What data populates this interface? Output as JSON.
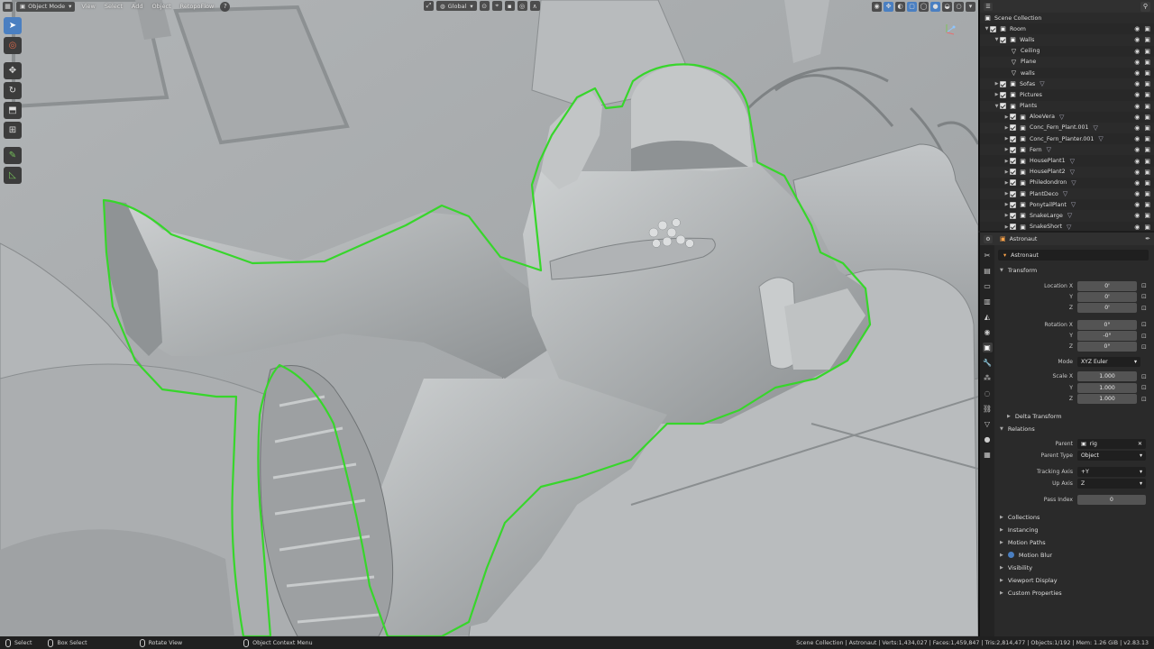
{
  "header": {
    "mode_label": "Object Mode",
    "menus": [
      "View",
      "Select",
      "Add",
      "Object",
      "RetopoFlow"
    ],
    "orientation_label": "Global"
  },
  "outliner": {
    "root_label": "Scene Collection",
    "rows": [
      {
        "label": "Room",
        "indent": 1,
        "type": "collection"
      },
      {
        "label": "Walls",
        "indent": 2,
        "type": "collection"
      },
      {
        "label": "Ceiling",
        "indent": 3,
        "type": "mesh"
      },
      {
        "label": "Plane",
        "indent": 3,
        "type": "mesh"
      },
      {
        "label": "walls",
        "indent": 3,
        "type": "mesh"
      },
      {
        "label": "Sofas",
        "indent": 2,
        "type": "collection"
      },
      {
        "label": "Pictures",
        "indent": 2,
        "type": "collection"
      },
      {
        "label": "Plants",
        "indent": 2,
        "type": "collection"
      },
      {
        "label": "AloeVera",
        "indent": 3,
        "type": "object"
      },
      {
        "label": "Conc_Fern_Plant.001",
        "indent": 3,
        "type": "object"
      },
      {
        "label": "Conc_Fern_Planter.001",
        "indent": 3,
        "type": "object"
      },
      {
        "label": "Fern",
        "indent": 3,
        "type": "object"
      },
      {
        "label": "HousePlant1",
        "indent": 3,
        "type": "object"
      },
      {
        "label": "HousePlant2",
        "indent": 3,
        "type": "object"
      },
      {
        "label": "Philedondron",
        "indent": 3,
        "type": "object"
      },
      {
        "label": "PlantDeco",
        "indent": 3,
        "type": "object"
      },
      {
        "label": "PonytailPlant",
        "indent": 3,
        "type": "object"
      },
      {
        "label": "SnakeLarge",
        "indent": 3,
        "type": "object"
      },
      {
        "label": "SnakeShort",
        "indent": 3,
        "type": "object"
      }
    ]
  },
  "properties": {
    "header_object": "Astronaut",
    "object_name": "Astronaut",
    "transform": {
      "title": "Transform",
      "location_x_label": "Location X",
      "y_label": "Y",
      "z_label": "Z",
      "location": [
        "0'",
        "0'",
        "0'"
      ],
      "rotation_x_label": "Rotation X",
      "rotation": [
        "0°",
        "-0°",
        "0°"
      ],
      "mode_label": "Mode",
      "mode_value": "XYZ Euler",
      "scale_x_label": "Scale X",
      "scale": [
        "1.000",
        "1.000",
        "1.000"
      ]
    },
    "delta_transform": "Delta Transform",
    "relations": {
      "title": "Relations",
      "parent_label": "Parent",
      "parent_value": "rig",
      "parent_type_label": "Parent Type",
      "parent_type_value": "Object",
      "tracking_axis_label": "Tracking Axis",
      "tracking_axis_value": "+Y",
      "up_axis_label": "Up Axis",
      "up_axis_value": "Z",
      "pass_index_label": "Pass Index",
      "pass_index_value": "0"
    },
    "collapsed_sections": [
      "Collections",
      "Instancing",
      "Motion Paths",
      "Motion Blur",
      "Visibility",
      "Viewport Display",
      "Custom Properties"
    ]
  },
  "statusbar": {
    "select": "Select",
    "box_select": "Box Select",
    "rotate_view": "Rotate View",
    "context_menu": "Object Context Menu",
    "stats": "Scene Collection | Astronaut | Verts:1,434,027 | Faces:1,459,847 | Tris:2,814,477 | Objects:1/192 | Mem: 1.26 GiB | v2.83.13"
  },
  "colors": {
    "selection_outline": "#37d62b",
    "active_blue": "#4a7fc1",
    "viewport_bg": "#a4a8aa"
  }
}
